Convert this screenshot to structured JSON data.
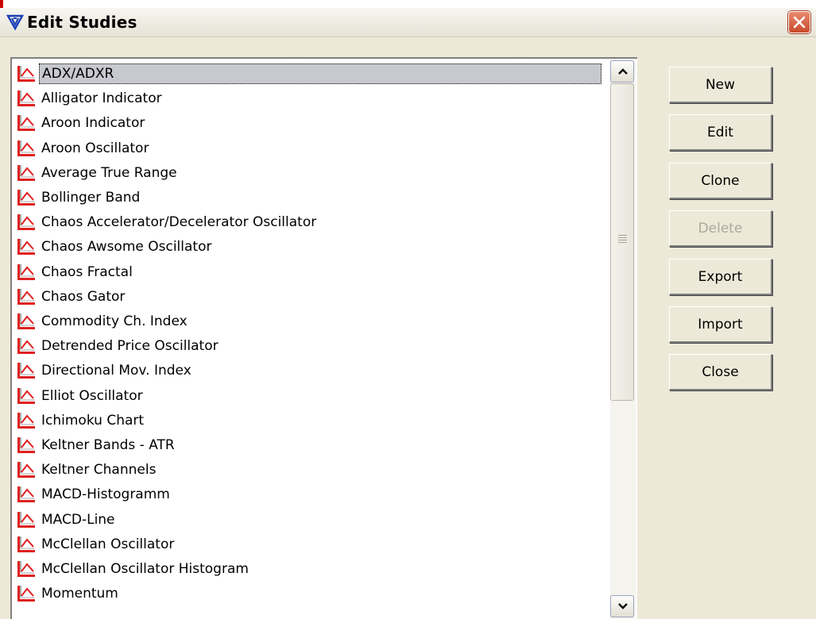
{
  "window": {
    "title": "Edit Studies",
    "app_icon": "tradesignal-logo-icon",
    "close_icon": "close-icon"
  },
  "studies": [
    {
      "label": "ADX/ADXR",
      "icon": "study-chart-icon",
      "selected": true
    },
    {
      "label": "Alligator Indicator",
      "icon": "study-chart-icon"
    },
    {
      "label": "Aroon Indicator",
      "icon": "study-chart-icon"
    },
    {
      "label": "Aroon Oscillator",
      "icon": "study-chart-icon"
    },
    {
      "label": "Average True Range",
      "icon": "study-chart-icon"
    },
    {
      "label": "Bollinger Band",
      "icon": "study-chart-icon"
    },
    {
      "label": "Chaos Accelerator/Decelerator Oscillator",
      "icon": "study-chart-icon"
    },
    {
      "label": "Chaos Awsome Oscillator",
      "icon": "study-chart-icon"
    },
    {
      "label": "Chaos Fractal",
      "icon": "study-chart-icon"
    },
    {
      "label": "Chaos Gator",
      "icon": "study-chart-icon"
    },
    {
      "label": "Commodity Ch. Index",
      "icon": "study-chart-icon"
    },
    {
      "label": "Detrended Price Oscillator",
      "icon": "study-chart-icon"
    },
    {
      "label": "Directional Mov. Index",
      "icon": "study-chart-icon"
    },
    {
      "label": "Elliot Oscillator",
      "icon": "study-chart-icon"
    },
    {
      "label": "Ichimoku Chart",
      "icon": "study-chart-icon"
    },
    {
      "label": "Keltner Bands - ATR",
      "icon": "study-chart-icon"
    },
    {
      "label": "Keltner Channels",
      "icon": "study-chart-icon"
    },
    {
      "label": "MACD-Histogramm",
      "icon": "study-chart-icon"
    },
    {
      "label": "MACD-Line",
      "icon": "study-chart-icon"
    },
    {
      "label": "McClellan Oscillator",
      "icon": "study-chart-icon"
    },
    {
      "label": "McClellan Oscillator Histogram",
      "icon": "study-chart-icon"
    },
    {
      "label": "Momentum",
      "icon": "study-chart-icon"
    }
  ],
  "buttons": {
    "new": "New",
    "edit": "Edit",
    "clone": "Clone",
    "delete": "Delete",
    "export": "Export",
    "import": "Import",
    "close": "Close"
  },
  "scrollbar": {
    "up_icon": "chevron-up-icon",
    "down_icon": "chevron-down-icon"
  },
  "colors": {
    "dialog_bg": "#ece9d8",
    "selection_bg": "#c8c8d0",
    "close_button": "#d65a3a",
    "disabled_text": "#aca899"
  }
}
